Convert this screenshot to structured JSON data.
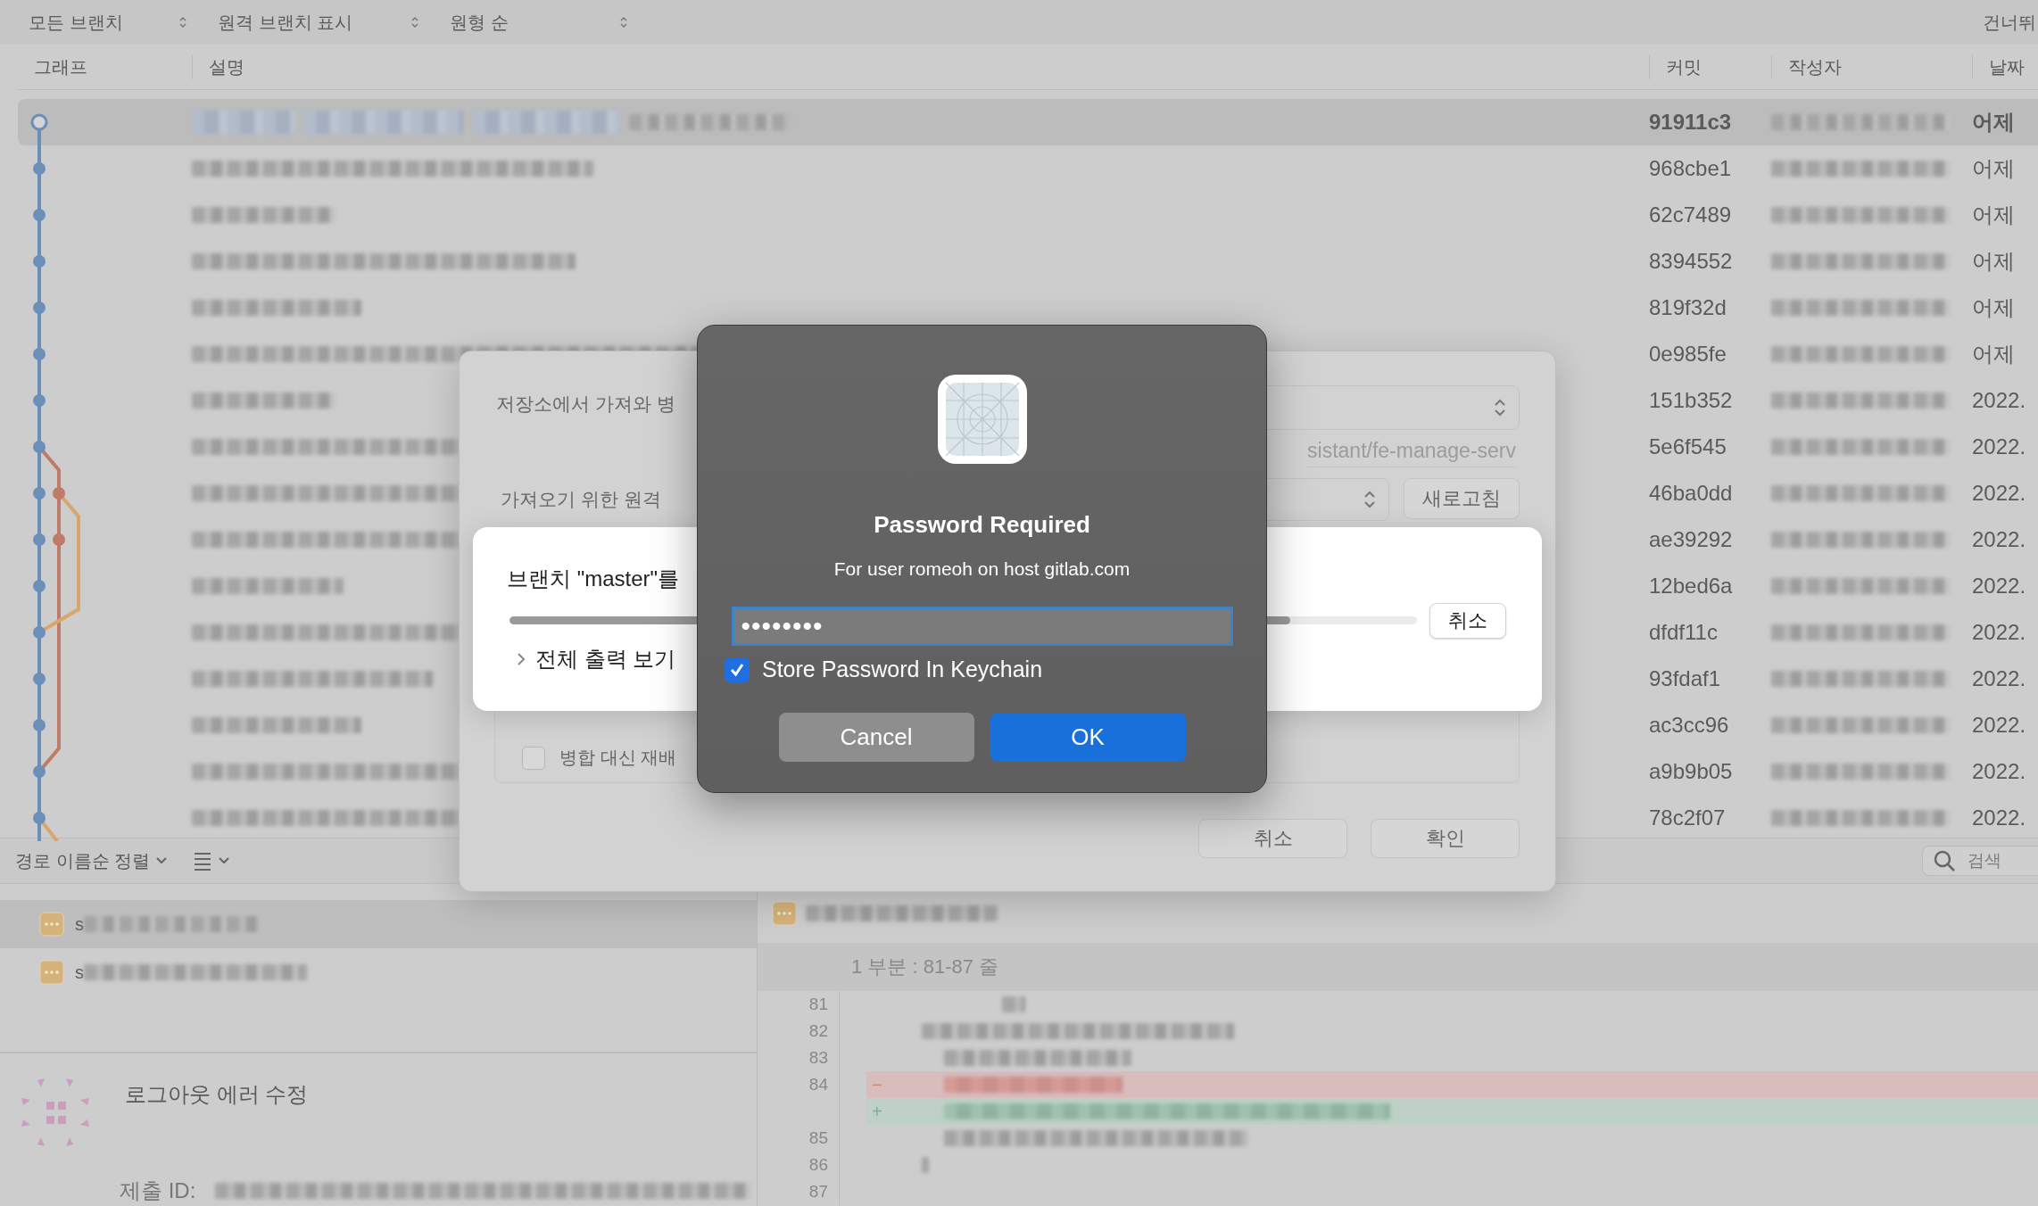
{
  "toolbar": {
    "filters": [
      {
        "label": "모든 브랜치"
      },
      {
        "label": "원격 브랜치 표시"
      },
      {
        "label": "원형 순"
      }
    ],
    "skip_label": "건너뛰"
  },
  "columns": [
    "그래프",
    "설명",
    "커밋",
    "작성자",
    "날짜"
  ],
  "commits": [
    {
      "hash": "91911c3",
      "date": "어제",
      "selected": true
    },
    {
      "hash": "968cbe1",
      "date": "어제",
      "selected": false
    },
    {
      "hash": "62c7489",
      "date": "어제",
      "selected": false
    },
    {
      "hash": "8394552",
      "date": "어제",
      "selected": false
    },
    {
      "hash": "819f32d",
      "date": "어제",
      "selected": false
    },
    {
      "hash": "0e985fe",
      "date": "어제",
      "selected": false
    },
    {
      "hash": "151b352",
      "date": "2022.",
      "selected": false
    },
    {
      "hash": "5e6f545",
      "date": "2022.",
      "selected": false
    },
    {
      "hash": "46ba0dd",
      "date": "2022.",
      "selected": false
    },
    {
      "hash": "ae39292",
      "date": "2022.",
      "selected": false
    },
    {
      "hash": "12bed6a",
      "date": "2022.",
      "selected": false
    },
    {
      "hash": "dfdf11c",
      "date": "2022.",
      "selected": false
    },
    {
      "hash": "93fdaf1",
      "date": "2022.",
      "selected": false
    },
    {
      "hash": "ac3cc96",
      "date": "2022.",
      "selected": false
    },
    {
      "hash": "a9b9b05",
      "date": "2022.",
      "selected": false
    },
    {
      "hash": "78c2f07",
      "date": "2022.",
      "selected": false
    }
  ],
  "file_list": {
    "sort_label": "경로 이름순 정렬",
    "files": [
      {
        "name_start": "s",
        "selected": true
      },
      {
        "name_start": "s",
        "selected": false
      }
    ]
  },
  "search": {
    "placeholder": "검색"
  },
  "commit_detail": {
    "message": "로그아웃 에러 수정",
    "id_label": "제출 ID:"
  },
  "diff": {
    "hunk_header": "1 부분 : 81-87 줄",
    "lines": [
      {
        "number": "81",
        "kind": "context"
      },
      {
        "number": "82",
        "kind": "context"
      },
      {
        "number": "83",
        "kind": "context"
      },
      {
        "number": "84",
        "kind": "removed",
        "marker": "−"
      },
      {
        "kind": "added",
        "marker": "+"
      },
      {
        "number": "85",
        "kind": "context"
      },
      {
        "number": "86",
        "kind": "context"
      },
      {
        "number": "87",
        "kind": "context"
      }
    ]
  },
  "fetch_sheet": {
    "title": "저장소에서 가져와 병",
    "remote_path": "sistant/fe-manage-serv",
    "remote_branch_label": "가져오기 위한 원격",
    "refresh_button": "새로고침",
    "options": [
      {
        "label": "병합 대신 재배",
        "checked": false
      }
    ],
    "buttons": [
      "취소",
      "확인"
    ]
  },
  "progress_sheet": {
    "message": "브랜치 \"master\"를",
    "level": 0.86,
    "cancel_button": "취소",
    "details_toggle": {
      "label": "전체 출력 보기",
      "expanded": false
    }
  },
  "password_dialog": {
    "title": "Password Required",
    "subtitle": "For user romeoh on host gitlab.com",
    "password_mask": "••••••••",
    "store_in_keychain": {
      "label": "Store Password In Keychain",
      "checked": true
    },
    "buttons": [
      {
        "label": "Cancel",
        "kind": "secondary"
      },
      {
        "label": "OK",
        "kind": "primary"
      }
    ]
  }
}
